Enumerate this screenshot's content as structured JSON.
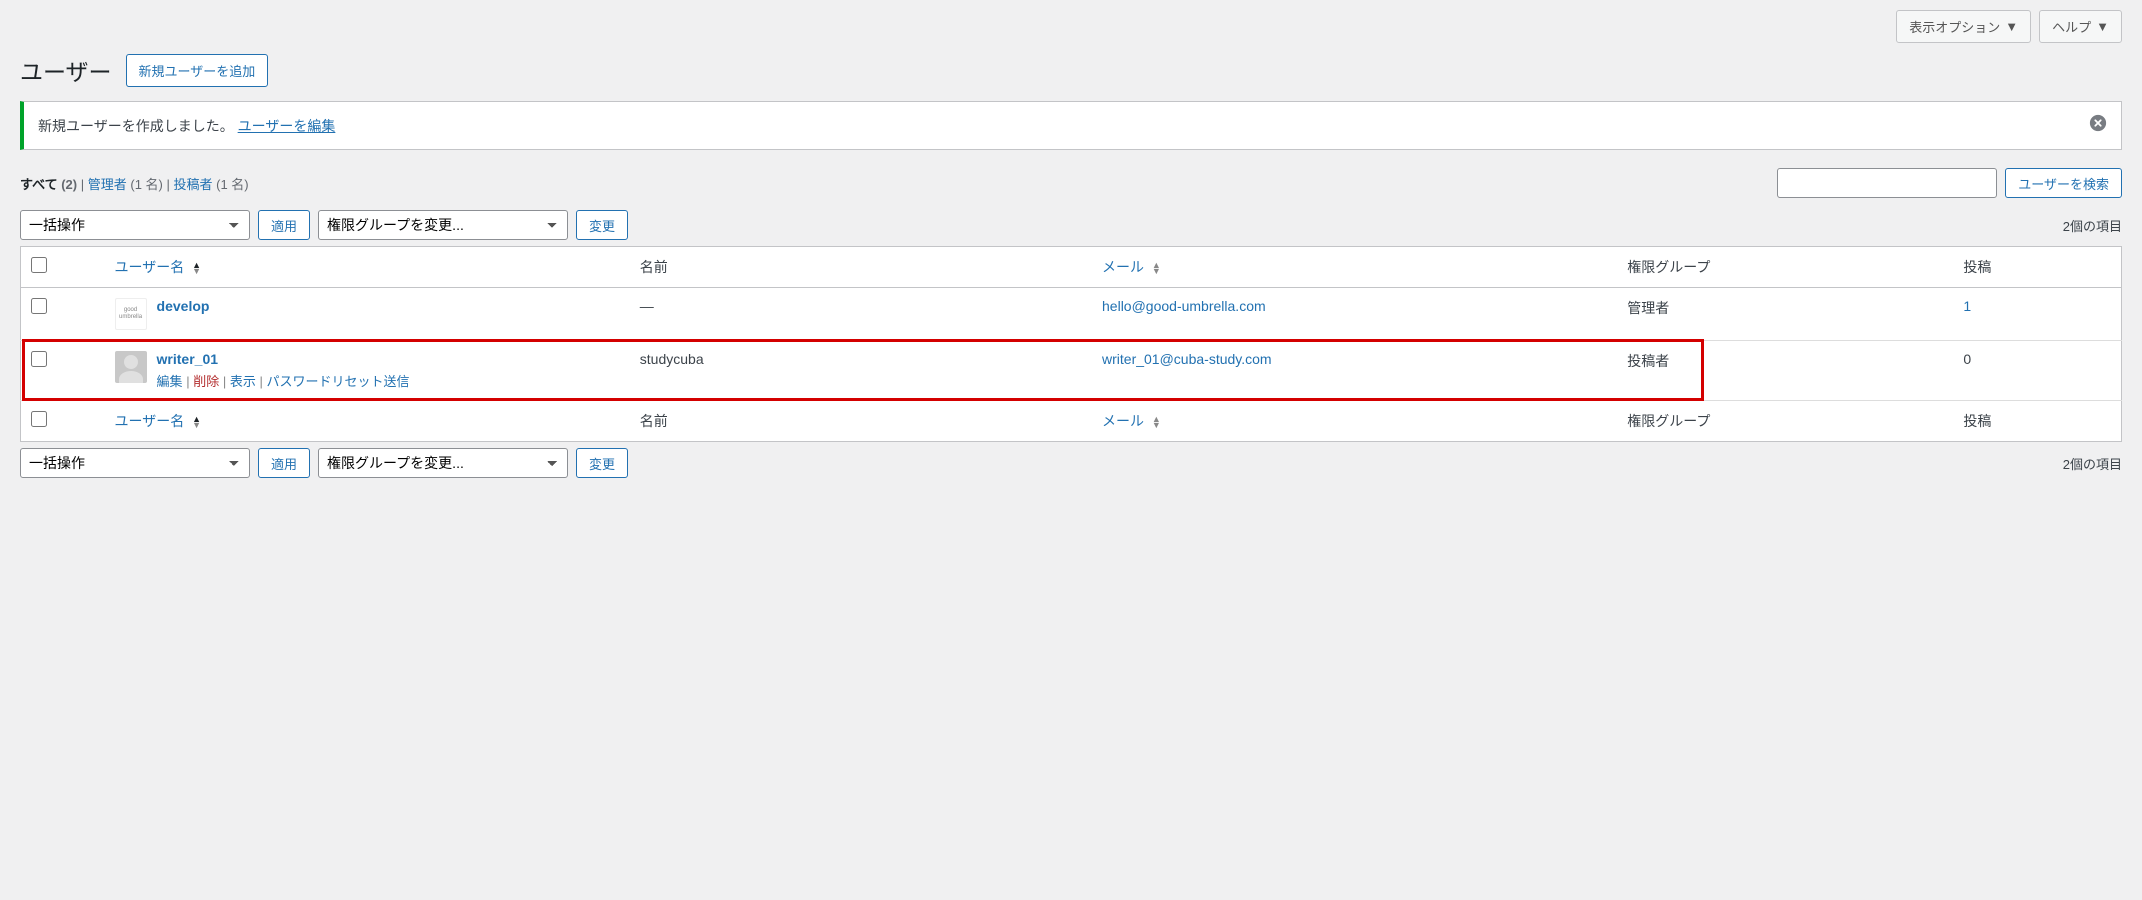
{
  "top": {
    "screen_options": "表示オプション",
    "help": "ヘルプ"
  },
  "header": {
    "title": "ユーザー",
    "add_new": "新規ユーザーを追加"
  },
  "notice": {
    "text": "新規ユーザーを作成しました。",
    "edit_link": "ユーザーを編集"
  },
  "filters": {
    "all_label": "すべて",
    "all_count": "(2)",
    "admin_label": "管理者",
    "admin_count": "(1 名)",
    "author_label": "投稿者",
    "author_count": "(1 名)",
    "sep": " | "
  },
  "search": {
    "button": "ユーザーを検索"
  },
  "bulk": {
    "default": "一括操作",
    "apply": "適用",
    "role_change": "権限グループを変更...",
    "change": "変更"
  },
  "paging": {
    "items": "2個の項目"
  },
  "columns": {
    "username": "ユーザー名",
    "name": "名前",
    "email": "メール",
    "role": "権限グループ",
    "posts": "投稿"
  },
  "users": [
    {
      "username": "develop",
      "name": "—",
      "email": "hello@good-umbrella.com",
      "role": "管理者",
      "posts": "1",
      "avatar_type": "logo",
      "avatar_text": "good umbrella",
      "show_actions": false
    },
    {
      "username": "writer_01",
      "name": "studycuba",
      "email": "writer_01@cuba-study.com",
      "role": "投稿者",
      "posts": "0",
      "avatar_type": "blank",
      "show_actions": true
    }
  ],
  "actions": {
    "edit": "編集",
    "delete": "削除",
    "view": "表示",
    "password_reset": "パスワードリセット送信"
  }
}
